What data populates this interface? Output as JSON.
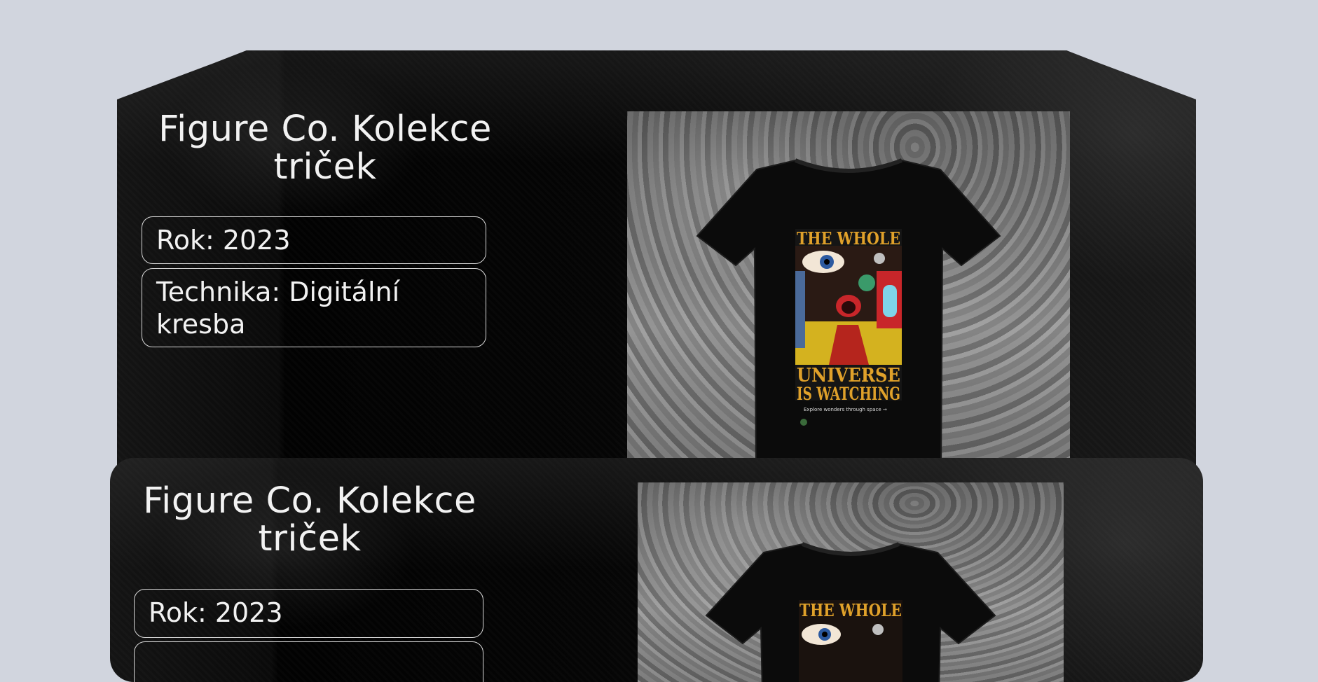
{
  "cards": [
    {
      "title_line1": "Figure Co. Kolekce",
      "title_line2": "triček",
      "year_label": "Rok: 2023",
      "technique_label": "Technika: Digitální kresba"
    },
    {
      "title_line1": "Figure Co. Kolekce",
      "title_line2": "triček",
      "year_label": "Rok: 2023"
    }
  ],
  "shirt_print": {
    "line1": "THE WHOLE",
    "line2": "UNIVERSE",
    "line3": "IS WATCHING",
    "caption": "Explore wonders through space →",
    "accent": "#e0a12a"
  },
  "colors": {
    "page_bg": "#d1d5de",
    "card_bg": "#050505",
    "text": "#f2f2f2"
  }
}
